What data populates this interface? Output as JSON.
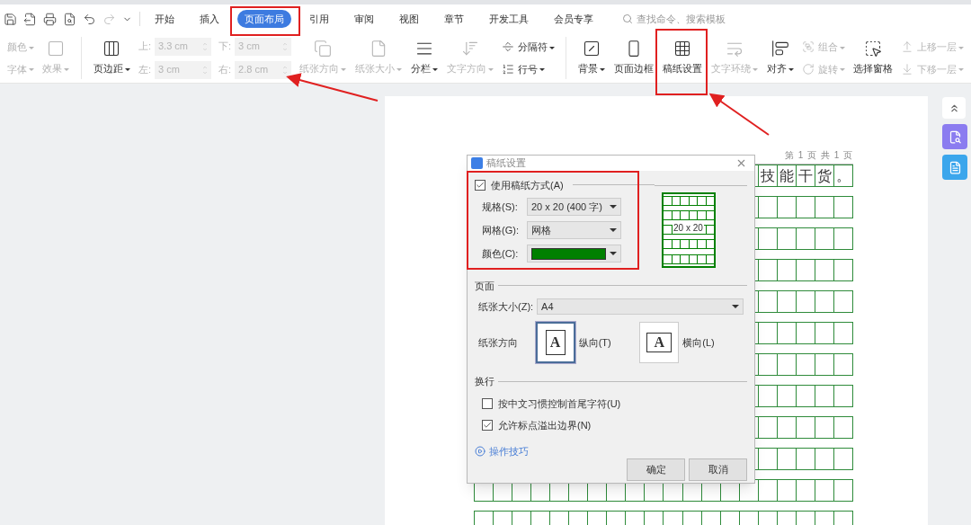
{
  "tabs": [
    {
      "label": "开始",
      "selected": false
    },
    {
      "label": "插入",
      "selected": false
    },
    {
      "label": "页面布局",
      "selected": true
    },
    {
      "label": "引用",
      "selected": false
    },
    {
      "label": "审阅",
      "selected": false
    },
    {
      "label": "视图",
      "selected": false
    },
    {
      "label": "章节",
      "selected": false
    },
    {
      "label": "开发工具",
      "selected": false
    },
    {
      "label": "会员专享",
      "selected": false
    }
  ],
  "search": {
    "placeholder": "查找命令、搜索模板"
  },
  "ribbon": [
    {
      "kind": "stack",
      "items": [
        {
          "label": "颜色",
          "dropdown": true,
          "disabled": true
        },
        {
          "label": "字体",
          "dropdown": true,
          "disabled": true
        }
      ]
    },
    {
      "kind": "large",
      "label": "效果",
      "dropdown": true,
      "disabled": true
    },
    {
      "kind": "separator"
    },
    {
      "kind": "large",
      "label": "页边距",
      "dropdown": true,
      "disabled": false
    },
    {
      "kind": "fields",
      "disabled": true,
      "items": [
        {
          "label": "上:",
          "value": "3.3 cm"
        },
        {
          "label": "下:",
          "value": "3 cm"
        },
        {
          "label": "左:",
          "value": "3 cm"
        },
        {
          "label": "右:",
          "value": "2.8 cm"
        }
      ]
    },
    {
      "kind": "large",
      "label": "纸张方向",
      "dropdown": true,
      "disabled": true
    },
    {
      "kind": "large",
      "label": "纸张大小",
      "dropdown": true,
      "disabled": true
    },
    {
      "kind": "large",
      "label": "分栏",
      "dropdown": true,
      "disabled": false
    },
    {
      "kind": "large",
      "label": "文字方向",
      "dropdown": true,
      "disabled": true
    },
    {
      "kind": "stack",
      "items": [
        {
          "label": "分隔符",
          "dropdown": true,
          "disabled": false
        },
        {
          "label": "行号",
          "dropdown": true,
          "disabled": false
        }
      ]
    },
    {
      "kind": "separator"
    },
    {
      "kind": "large",
      "label": "背景",
      "dropdown": true,
      "disabled": false
    },
    {
      "kind": "large",
      "label": "页面边框",
      "dropdown": false,
      "disabled": false
    },
    {
      "kind": "large",
      "label": "稿纸设置",
      "dropdown": false,
      "disabled": false
    },
    {
      "kind": "large",
      "label": "文字环绕",
      "dropdown": true,
      "disabled": true
    },
    {
      "kind": "large",
      "label": "对齐",
      "dropdown": true,
      "disabled": false
    },
    {
      "kind": "stack",
      "items": [
        {
          "label": "组合",
          "dropdown": true,
          "disabled": true
        },
        {
          "label": "旋转",
          "dropdown": true,
          "disabled": true
        }
      ]
    },
    {
      "kind": "large",
      "label": "选择窗格",
      "dropdown": false,
      "disabled": false
    },
    {
      "kind": "stack",
      "items": [
        {
          "label": "上移一层",
          "dropdown": true,
          "disabled": true
        },
        {
          "label": "下移一层",
          "dropdown": true,
          "disabled": true
        }
      ]
    }
  ],
  "document": {
    "header": "第 1 页 共 1 页",
    "first_row_tail": [
      "技",
      "能",
      "干",
      "货",
      "。"
    ]
  },
  "dialog": {
    "title": "稿纸设置",
    "use_grid": {
      "label": "使用稿纸方式(A)",
      "checked": true
    },
    "fields": [
      {
        "kind": "select",
        "label": "规格(S):",
        "value": "20 x 20 (400 字)"
      },
      {
        "kind": "select",
        "label": "网格(G):",
        "value": "网格"
      },
      {
        "kind": "color",
        "label": "颜色(C):",
        "color": "#008000"
      }
    ],
    "preview_label": "20 x 20",
    "page_section": "页面",
    "paper_size": {
      "label": "纸张大小(Z):",
      "value": "A4"
    },
    "orientation": {
      "label": "纸张方向",
      "options": [
        {
          "label": "纵向(T)",
          "glyph": "A",
          "selected": true
        },
        {
          "label": "横向(L)",
          "glyph": "A",
          "selected": false
        }
      ]
    },
    "wrap_section": "换行",
    "options": [
      {
        "label": "按中文习惯控制首尾字符(U)",
        "checked": false
      },
      {
        "label": "允许标点溢出边界(N)",
        "checked": true
      }
    ],
    "tips_link": "操作技巧",
    "buttons": [
      "确定",
      "取消"
    ]
  }
}
